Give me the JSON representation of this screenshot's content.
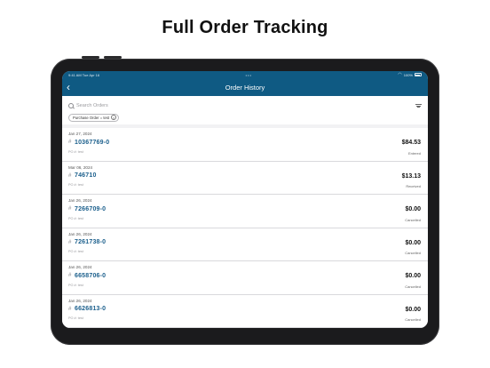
{
  "headline": "Full Order Tracking",
  "status_bar": {
    "time_date": "9:41 AM   Tue Apr 16",
    "center": "•••",
    "battery": "100%"
  },
  "nav": {
    "title": "Order History",
    "back_symbol": "‹"
  },
  "search": {
    "placeholder": "Search Orders"
  },
  "filter_chip": {
    "label": "Purchase Order = test",
    "close_symbol": "×"
  },
  "orders": [
    {
      "date": "Jan 27, 2024",
      "hash": "#",
      "number": "10367769-0",
      "po": "PO #: test",
      "amount": "$84.53",
      "status": "Entered"
    },
    {
      "date": "Mar 06, 2024",
      "hash": "#",
      "number": "746710",
      "po": "PO #: test",
      "amount": "$13.13",
      "status": "Received"
    },
    {
      "date": "Jan 26, 2024",
      "hash": "#",
      "number": "7266709-0",
      "po": "PO #: test",
      "amount": "$0.00",
      "status": "Cancelled"
    },
    {
      "date": "Jan 26, 2024",
      "hash": "#",
      "number": "7261738-0",
      "po": "PO #: test",
      "amount": "$0.00",
      "status": "Cancelled"
    },
    {
      "date": "Jan 26, 2024",
      "hash": "#",
      "number": "6658706-0",
      "po": "PO #: test",
      "amount": "$0.00",
      "status": "Cancelled"
    },
    {
      "date": "Jan 26, 2024",
      "hash": "#",
      "number": "6626813-0",
      "po": "PO #: test",
      "amount": "$0.00",
      "status": "Cancelled"
    }
  ],
  "colors": {
    "nav_bar": "#0f5a83",
    "order_number": "#1b5f8c",
    "device_frame": "#1b1b1d"
  },
  "icons": {
    "back": "chevron-left-icon",
    "search": "search-icon",
    "filter": "filter-icon",
    "chip_close": "close-circle-icon",
    "wifi": "wifi-icon",
    "battery": "battery-icon"
  }
}
